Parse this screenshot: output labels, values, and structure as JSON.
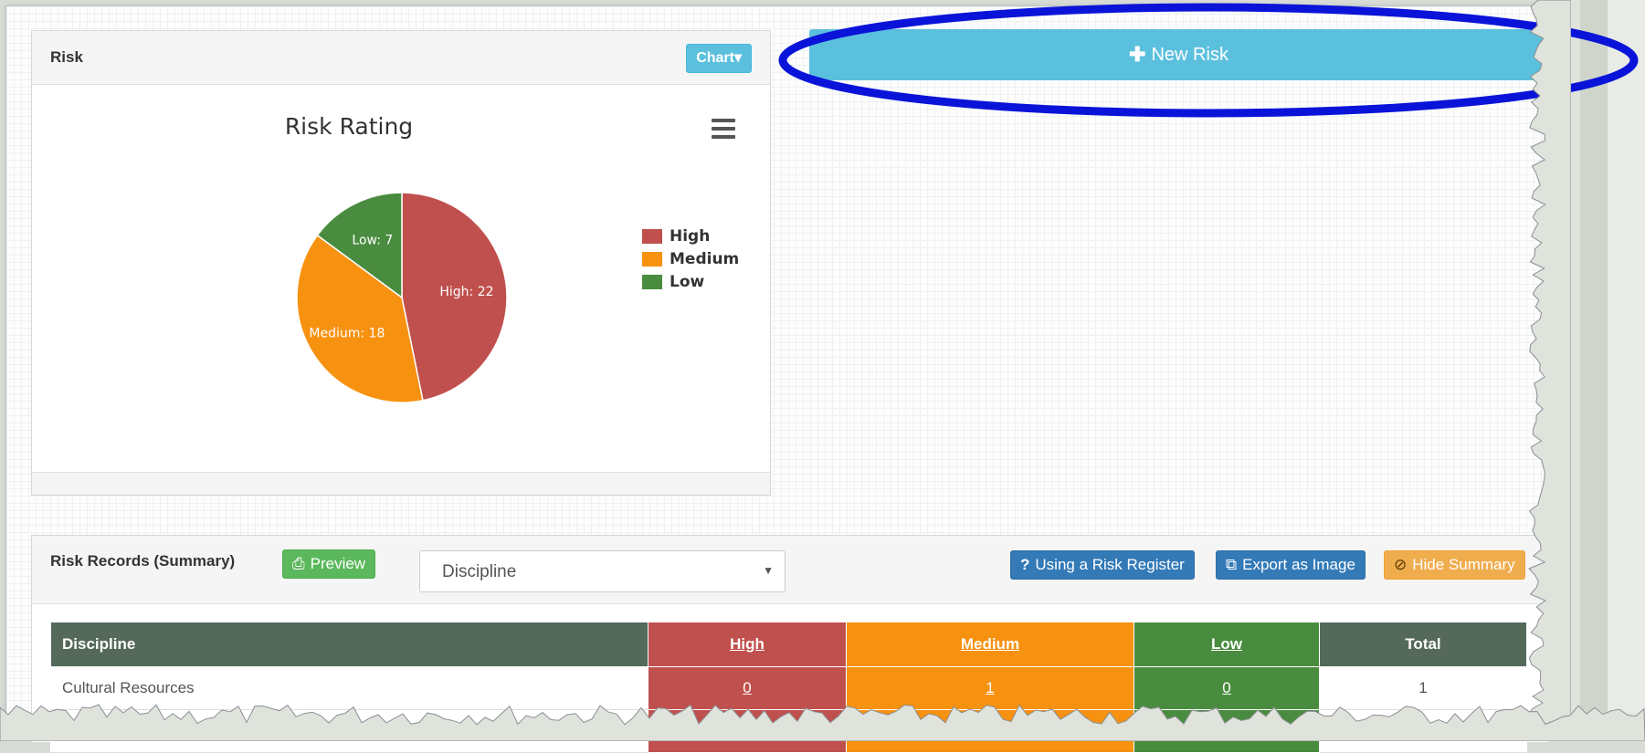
{
  "risk_panel": {
    "title": "Risk",
    "chart_button": "Chart▾",
    "menu_icon": "hamburger-icon"
  },
  "chart_data": {
    "type": "pie",
    "title": "Risk Rating",
    "slices": [
      {
        "label": "High",
        "value": 22,
        "color": "#c0504d",
        "data_label": "High: 22"
      },
      {
        "label": "Medium",
        "value": 18,
        "color": "#f79110",
        "data_label": "Medium: 18"
      },
      {
        "label": "Low",
        "value": 7,
        "color": "#4a8c3f",
        "data_label": "Low: 7"
      }
    ],
    "legend": [
      "High",
      "Medium",
      "Low"
    ],
    "legend_placement": "right"
  },
  "new_risk": {
    "label": "New Risk",
    "icon": "plus-icon"
  },
  "summary": {
    "title": "Risk Records (Summary)",
    "preview_label": "Preview",
    "preview_icon": "printer-icon",
    "select_value": "Discipline",
    "help_label": "Using a Risk Register",
    "help_icon": "question-icon",
    "export_label": "Export as Image",
    "export_icon": "external-link-icon",
    "hide_label": "Hide Summary",
    "hide_icon": "eye-slash-icon",
    "columns": [
      "Discipline",
      "High",
      "Medium",
      "Low",
      "Total"
    ],
    "rows": [
      {
        "discipline": "Cultural Resources",
        "high": "0",
        "medium": "1",
        "low": "0",
        "total": "1"
      }
    ]
  },
  "colors": {
    "high": "#c0504d",
    "medium": "#f79110",
    "low": "#4a8c3f",
    "header": "#54695a",
    "info": "#5bc0de",
    "annotation": "#0a14d8"
  }
}
